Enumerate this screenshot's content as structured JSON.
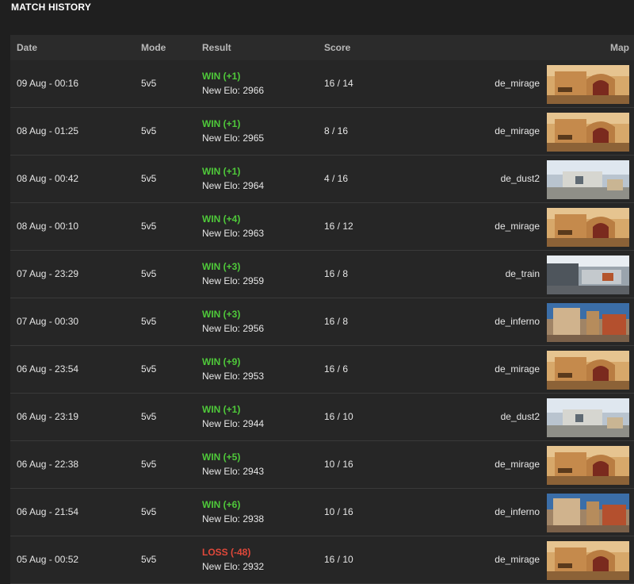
{
  "title": "MATCH HISTORY",
  "columns": {
    "date": "Date",
    "mode": "Mode",
    "result": "Result",
    "score": "Score",
    "map": "Map"
  },
  "colors": {
    "win": "#4fc93a",
    "loss": "#e0483a",
    "background": "#1f1f1f",
    "panel": "#262626"
  },
  "matches": [
    {
      "date": "09 Aug - 00:16",
      "mode": "5v5",
      "result": "WIN (+1)",
      "outcome": "win",
      "elo": "New Elo: 2966",
      "score": "16 / 14",
      "map": "de_mirage"
    },
    {
      "date": "08 Aug - 01:25",
      "mode": "5v5",
      "result": "WIN (+1)",
      "outcome": "win",
      "elo": "New Elo: 2965",
      "score": "8 / 16",
      "map": "de_mirage"
    },
    {
      "date": "08 Aug - 00:42",
      "mode": "5v5",
      "result": "WIN (+1)",
      "outcome": "win",
      "elo": "New Elo: 2964",
      "score": "4 / 16",
      "map": "de_dust2"
    },
    {
      "date": "08 Aug - 00:10",
      "mode": "5v5",
      "result": "WIN (+4)",
      "outcome": "win",
      "elo": "New Elo: 2963",
      "score": "16 / 12",
      "map": "de_mirage"
    },
    {
      "date": "07 Aug - 23:29",
      "mode": "5v5",
      "result": "WIN (+3)",
      "outcome": "win",
      "elo": "New Elo: 2959",
      "score": "16 / 8",
      "map": "de_train"
    },
    {
      "date": "07 Aug - 00:30",
      "mode": "5v5",
      "result": "WIN (+3)",
      "outcome": "win",
      "elo": "New Elo: 2956",
      "score": "16 / 8",
      "map": "de_inferno"
    },
    {
      "date": "06 Aug - 23:54",
      "mode": "5v5",
      "result": "WIN (+9)",
      "outcome": "win",
      "elo": "New Elo: 2953",
      "score": "16 / 6",
      "map": "de_mirage"
    },
    {
      "date": "06 Aug - 23:19",
      "mode": "5v5",
      "result": "WIN (+1)",
      "outcome": "win",
      "elo": "New Elo: 2944",
      "score": "16 / 10",
      "map": "de_dust2"
    },
    {
      "date": "06 Aug - 22:38",
      "mode": "5v5",
      "result": "WIN (+5)",
      "outcome": "win",
      "elo": "New Elo: 2943",
      "score": "10 / 16",
      "map": "de_mirage"
    },
    {
      "date": "06 Aug - 21:54",
      "mode": "5v5",
      "result": "WIN (+6)",
      "outcome": "win",
      "elo": "New Elo: 2938",
      "score": "10 / 16",
      "map": "de_inferno"
    },
    {
      "date": "05 Aug - 00:52",
      "mode": "5v5",
      "result": "LOSS (-48)",
      "outcome": "loss",
      "elo": "New Elo: 2932",
      "score": "16 / 10",
      "map": "de_mirage"
    }
  ]
}
